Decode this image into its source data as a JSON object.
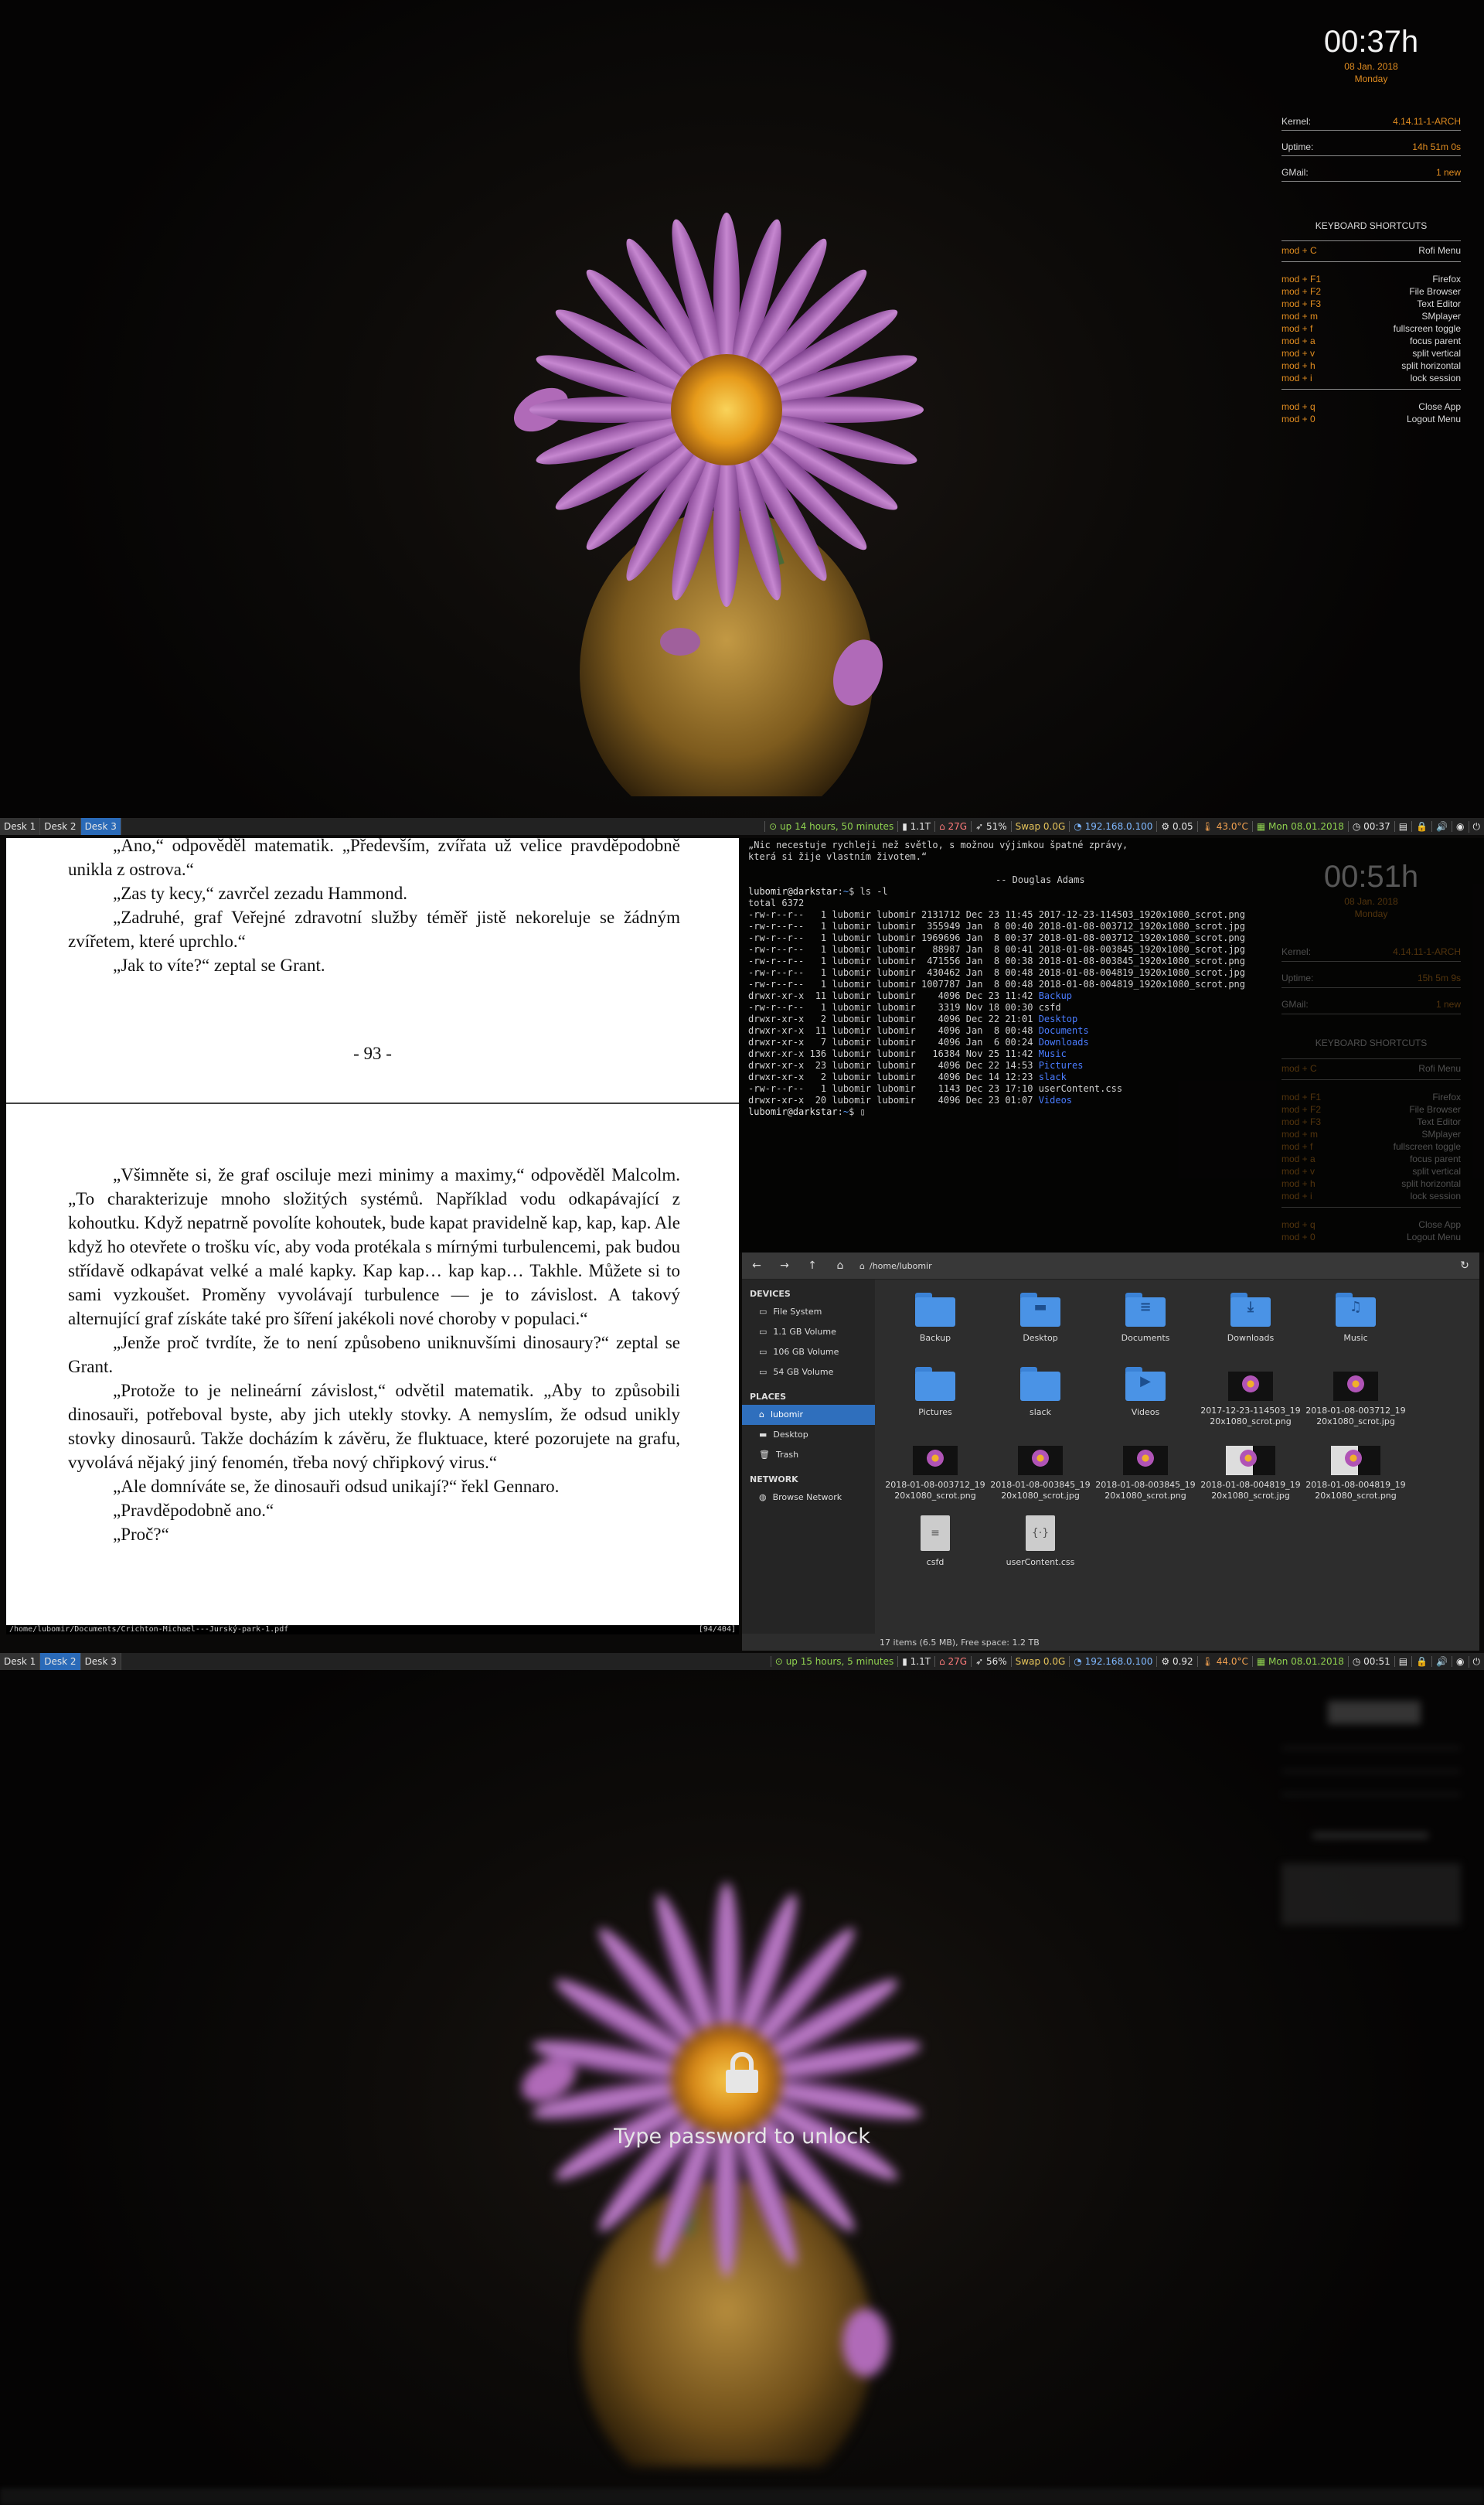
{
  "workspaces": [
    "Desk 1",
    "Desk 2",
    "Desk 3"
  ],
  "screen1": {
    "active_ws": 2,
    "bar": {
      "uptime": "up 14 hours, 50 minutes",
      "disk1": "1.1T",
      "disk2": "27G",
      "brightness": "51%",
      "swap": "Swap 0.0G",
      "ip": "192.168.0.100",
      "load": "0.05",
      "temp": "43.0°C",
      "date": "Mon 08.01.2018",
      "time": "00:37"
    },
    "conky": {
      "clock": "00:37h",
      "date": "08 Jan. 2018",
      "day": "Monday"
    }
  },
  "conky_common": {
    "kernel_label": "Kernel:",
    "kernel_value": "4.14.11-1-ARCH",
    "uptime_label": "Uptime:",
    "uptime_value": "14h 51m 0s",
    "gmail_label": "GMail:",
    "gmail_value": "1 new",
    "shortcuts_title": "KEYBOARD SHORTCUTS",
    "shortcuts": [
      {
        "key": "mod + C",
        "action": "Rofi Menu"
      },
      {
        "key": "mod + F1",
        "action": "Firefox"
      },
      {
        "key": "mod + F2",
        "action": "File Browser"
      },
      {
        "key": "mod + F3",
        "action": "Text Editor"
      },
      {
        "key": "mod + m",
        "action": "SMplayer"
      },
      {
        "key": "mod + f",
        "action": "fullscreen toggle"
      },
      {
        "key": "mod + a",
        "action": "focus parent"
      },
      {
        "key": "mod + v",
        "action": "split vertical"
      },
      {
        "key": "mod + h",
        "action": "split horizontal"
      },
      {
        "key": "mod + i",
        "action": "lock session"
      },
      {
        "key": "mod + q",
        "action": "Close App"
      },
      {
        "key": "mod + 0",
        "action": "Logout Menu"
      }
    ]
  },
  "screen2": {
    "active_ws": 1,
    "bar": {
      "uptime": "up 15 hours, 5 minutes",
      "disk1": "1.1T",
      "disk2": "27G",
      "brightness": "56%",
      "swap": "Swap 0.0G",
      "ip": "192.168.0.100",
      "load": "0.92",
      "temp": "44.0°C",
      "date": "Mon 08.01.2018",
      "time": "00:51"
    },
    "pdf": {
      "page1_lines": [
        "„Ano,“ odpověděl matematik. „Především, zvířata už velice pravděpodobně unikla z ostrova.“",
        "„Zas ty kecy,“ zavrčel zezadu Hammond.",
        "„Zadruhé, graf Veřejné zdravotní služby téměř jistě nekoreluje se žádným zvířetem, které uprchlo.“",
        "„Jak to víte?“ zeptal se Grant."
      ],
      "page_number": "- 93 -",
      "page2_lines": [
        "„Všimněte si, že graf osciluje mezi minimy a maximy,“ odpověděl Malcolm. „To charakterizuje mnoho složitých systémů. Například vodu odkapávající z kohoutku. Když nepatrně povolíte kohoutek, bude kapat pravidelně kap, kap, kap. Ale když ho otevřete o trošku víc, aby voda protékala s mírnými turbulencemi, pak budou střídavě odkapávat velké a malé kapky. Kap kap… kap kap… Takhle. Můžete si to sami vyzkoušet. Proměny vyvolávají turbulence — je to závislost. A takový alternující graf získáte také pro šíření jakékoli nové choroby v populaci.“",
        "„Jenže proč tvrdíte, že to není způsobeno uniknuvšími dinosaury?“ zeptal se Grant.",
        "„Protože to je nelineární závislost,“ odvětil matematik. „Aby to způsobili dinosauři, potřeboval byste, aby jich utekly stovky. A nemyslím, že odsud unikly stovky dinosaurů. Takže docházím k závěru, že fluktuace, které pozorujete na grafu, vyvolává nějaký jiný fenomén, třeba nový chřipkový virus.“",
        "„Ale domníváte se, že dinosauři odsud unikají?“ řekl Gennaro.",
        "„Pravděpodobně ano.“",
        "„Proč?“"
      ],
      "status_path": "/home/lubomir/Documents/Crichton-Michael---Jurský-park-1.pdf",
      "status_page": "[94/404]"
    },
    "terminal": {
      "quote1": "„Nic necestuje rychleji než světlo, s možnou výjimkou špatné zprávy,",
      "quote2": "která si žije vlastním životem.“",
      "quote_author": "-- Douglas Adams",
      "prompt_user": "lubomir@darkstar",
      "prompt_path": "~",
      "command": "ls -l",
      "total": "total 6372",
      "entries": [
        {
          "perm": "-rw-r--r--",
          "links": " 1",
          "size": "2131712",
          "date": "Dec 23 11:45",
          "name": "2017-12-23-114503_1920x1080_scrot.png",
          "dir": false
        },
        {
          "perm": "-rw-r--r--",
          "links": " 1",
          "size": " 355949",
          "date": "Jan  8 00:40",
          "name": "2018-01-08-003712_1920x1080_scrot.jpg",
          "dir": false
        },
        {
          "perm": "-rw-r--r--",
          "links": " 1",
          "size": "1969696",
          "date": "Jan  8 00:37",
          "name": "2018-01-08-003712_1920x1080_scrot.png",
          "dir": false
        },
        {
          "perm": "-rw-r--r--",
          "links": " 1",
          "size": "  88987",
          "date": "Jan  8 00:41",
          "name": "2018-01-08-003845_1920x1080_scrot.jpg",
          "dir": false
        },
        {
          "perm": "-rw-r--r--",
          "links": " 1",
          "size": " 471556",
          "date": "Jan  8 00:38",
          "name": "2018-01-08-003845_1920x1080_scrot.png",
          "dir": false
        },
        {
          "perm": "-rw-r--r--",
          "links": " 1",
          "size": " 430462",
          "date": "Jan  8 00:48",
          "name": "2018-01-08-004819_1920x1080_scrot.jpg",
          "dir": false
        },
        {
          "perm": "-rw-r--r--",
          "links": " 1",
          "size": "1007787",
          "date": "Jan  8 00:48",
          "name": "2018-01-08-004819_1920x1080_scrot.png",
          "dir": false
        },
        {
          "perm": "drwxr-xr-x",
          "links": "11",
          "size": "   4096",
          "date": "Dec 23 11:42",
          "name": "Backup",
          "dir": true
        },
        {
          "perm": "-rw-r--r--",
          "links": " 1",
          "size": "   3319",
          "date": "Nov 18 00:30",
          "name": "csfd",
          "dir": false
        },
        {
          "perm": "drwxr-xr-x",
          "links": " 2",
          "size": "   4096",
          "date": "Dec 22 21:01",
          "name": "Desktop",
          "dir": true
        },
        {
          "perm": "drwxr-xr-x",
          "links": "11",
          "size": "   4096",
          "date": "Jan  8 00:48",
          "name": "Documents",
          "dir": true
        },
        {
          "perm": "drwxr-xr-x",
          "links": " 7",
          "size": "   4096",
          "date": "Jan  6 00:24",
          "name": "Downloads",
          "dir": true
        },
        {
          "perm": "drwxr-xr-x",
          "links": "136",
          "size": "  16384",
          "date": "Nov 25 11:42",
          "name": "Music",
          "dir": true
        },
        {
          "perm": "drwxr-xr-x",
          "links": "23",
          "size": "   4096",
          "date": "Dec 22 14:53",
          "name": "Pictures",
          "dir": true
        },
        {
          "perm": "drwxr-xr-x",
          "links": " 2",
          "size": "   4096",
          "date": "Dec 14 12:23",
          "name": "slack",
          "dir": true
        },
        {
          "perm": "-rw-r--r--",
          "links": " 1",
          "size": "   1143",
          "date": "Dec 23 17:10",
          "name": "userContent.css",
          "dir": false
        },
        {
          "perm": "drwxr-xr-x",
          "links": "20",
          "size": "   4096",
          "date": "Dec 23 01:07",
          "name": "Videos",
          "dir": true
        }
      ],
      "owner": "lubomir",
      "group": "lubomir"
    },
    "ghost_conky": {
      "clock": "00:51h",
      "date": "08 Jan. 2018",
      "day": "Monday",
      "kernel_value": "4.14.11-1-ARCH",
      "uptime_value": "15h 5m 9s",
      "gmail_value": "1 new"
    },
    "filemanager": {
      "path": "/home/lubomir",
      "devices_title": "DEVICES",
      "devices": [
        "File System",
        "1.1 GB Volume",
        "106 GB Volume",
        "54 GB Volume"
      ],
      "places_title": "PLACES",
      "places": [
        "lubomir",
        "Desktop",
        "Trash"
      ],
      "network_title": "NETWORK",
      "network": [
        "Browse Network"
      ],
      "items": [
        {
          "name": "Backup",
          "kind": "folder",
          "glyph": ""
        },
        {
          "name": "Desktop",
          "kind": "folder",
          "glyph": "▬"
        },
        {
          "name": "Documents",
          "kind": "folder",
          "glyph": "≡"
        },
        {
          "name": "Downloads",
          "kind": "folder",
          "glyph": "⤓"
        },
        {
          "name": "Music",
          "kind": "folder",
          "glyph": "♫"
        },
        {
          "name": "Pictures",
          "kind": "folder",
          "glyph": ""
        },
        {
          "name": "slack",
          "kind": "folder",
          "glyph": ""
        },
        {
          "name": "Videos",
          "kind": "folder",
          "glyph": "▶"
        },
        {
          "name": "2017-12-23-114503_1920x1080_scrot.png",
          "kind": "image"
        },
        {
          "name": "2018-01-08-003712_1920x1080_scrot.jpg",
          "kind": "image"
        },
        {
          "name": "2018-01-08-003712_1920x1080_scrot.png",
          "kind": "image"
        },
        {
          "name": "2018-01-08-003845_1920x1080_scrot.jpg",
          "kind": "image"
        },
        {
          "name": "2018-01-08-003845_1920x1080_scrot.png",
          "kind": "image"
        },
        {
          "name": "2018-01-08-004819_1920x1080_scrot.jpg",
          "kind": "image-light"
        },
        {
          "name": "2018-01-08-004819_1920x1080_scrot.png",
          "kind": "image-light"
        },
        {
          "name": "csfd",
          "kind": "text"
        },
        {
          "name": "userContent.css",
          "kind": "css"
        }
      ],
      "status": "17 items (6.5 MB), Free space: 1.2 TB"
    }
  },
  "screen3": {
    "lock_message": "Type password to unlock"
  },
  "colors": {
    "accent": "#e08c20",
    "workspace_active": "#2a6ab8",
    "selection": "#2f6fbd"
  }
}
